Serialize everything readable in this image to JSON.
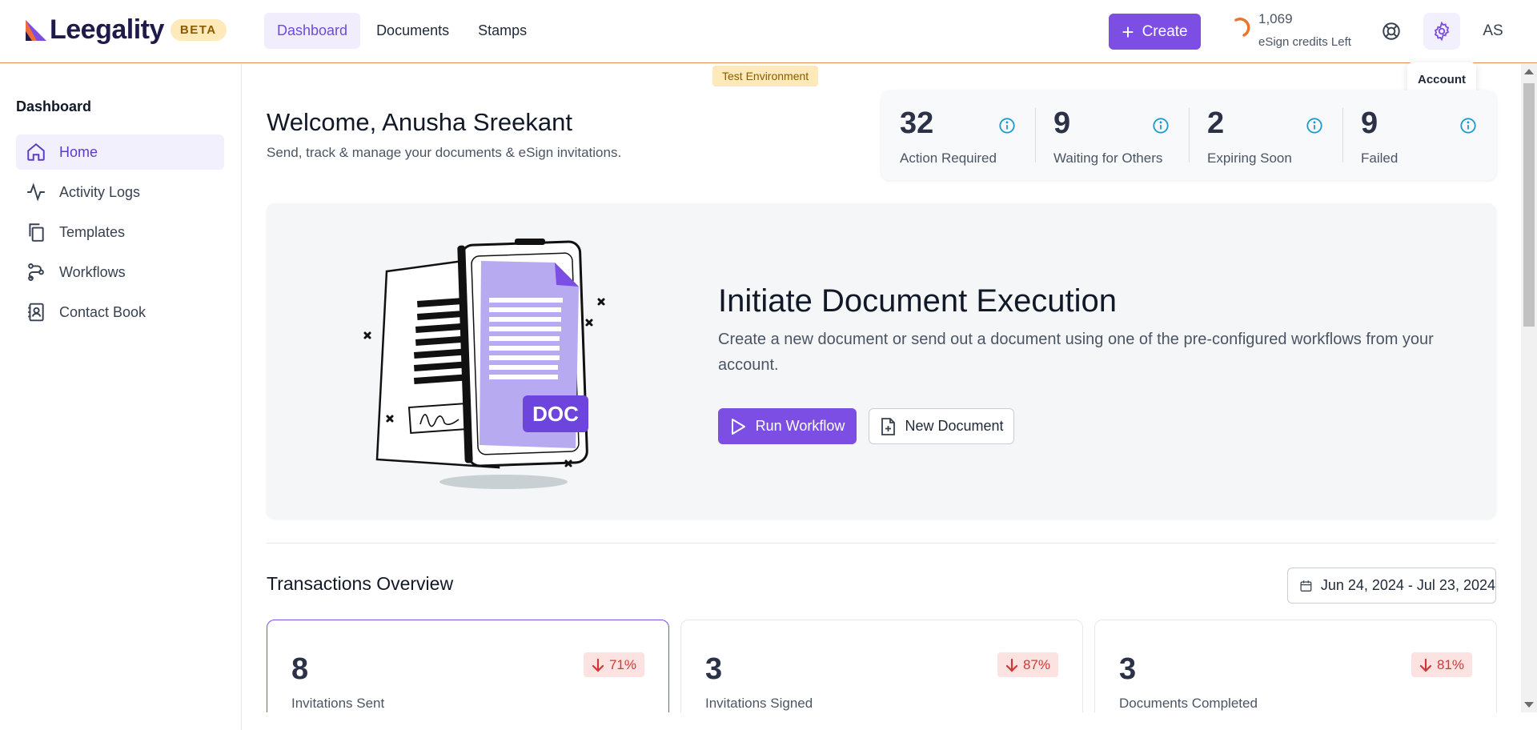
{
  "brand": {
    "name": "Leegality",
    "badge": "BETA",
    "accent": "#7c4ee4"
  },
  "topnav": [
    {
      "label": "Dashboard",
      "active": true
    },
    {
      "label": "Documents",
      "active": false
    },
    {
      "label": "Stamps",
      "active": false
    }
  ],
  "header": {
    "create_label": "Create",
    "credits_value": "1,069",
    "credits_label": "eSign credits Left",
    "avatar_initials": "AS",
    "tooltip": "Account"
  },
  "sidebar": {
    "title": "Dashboard",
    "items": [
      {
        "label": "Home",
        "icon": "home-icon",
        "active": true
      },
      {
        "label": "Activity Logs",
        "icon": "activity-icon",
        "active": false
      },
      {
        "label": "Templates",
        "icon": "copy-icon",
        "active": false
      },
      {
        "label": "Workflows",
        "icon": "workflow-icon",
        "active": false
      },
      {
        "label": "Contact Book",
        "icon": "contact-book-icon",
        "active": false
      }
    ]
  },
  "env_badge": "Test Environment",
  "welcome": {
    "title": "Welcome, Anusha Sreekant",
    "subtitle": "Send, track & manage your documents & eSign invitations."
  },
  "stats": [
    {
      "value": "32",
      "label": "Action Required"
    },
    {
      "value": "9",
      "label": "Waiting for Others"
    },
    {
      "value": "2",
      "label": "Expiring Soon"
    },
    {
      "value": "9",
      "label": "Failed"
    }
  ],
  "hero": {
    "title": "Initiate Document Execution",
    "description": "Create a new document or send out a document using one of the pre-configured workflows from your account.",
    "primary_label": "Run Workflow",
    "secondary_label": "New Document",
    "illustration_label": "DOC"
  },
  "overview": {
    "title": "Transactions Overview",
    "date_range": "Jun 24, 2024 - Jul 23, 2024",
    "cards": [
      {
        "value": "8",
        "label": "Invitations Sent",
        "change": "71%",
        "direction": "down",
        "selected": true
      },
      {
        "value": "3",
        "label": "Invitations Signed",
        "change": "87%",
        "direction": "down",
        "selected": false
      },
      {
        "value": "3",
        "label": "Documents Completed",
        "change": "81%",
        "direction": "down",
        "selected": false
      }
    ]
  }
}
